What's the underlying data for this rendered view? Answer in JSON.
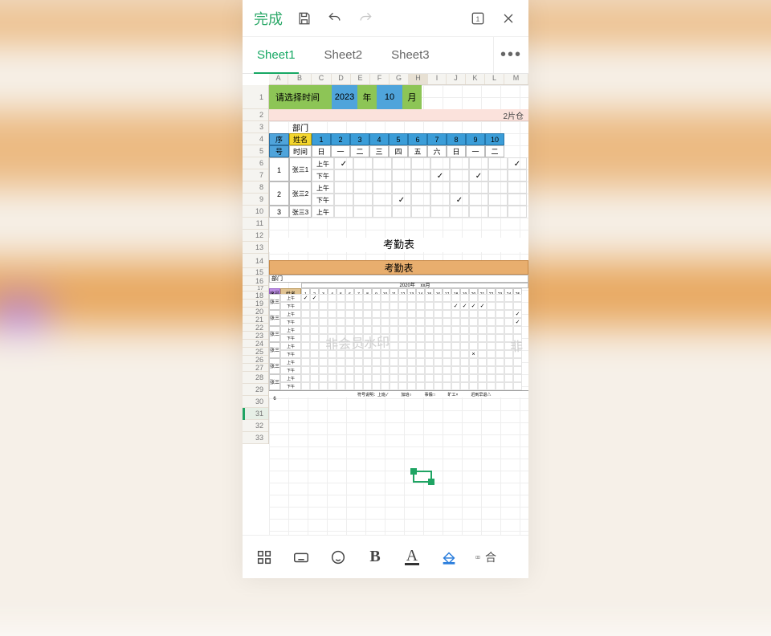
{
  "topbar": {
    "done": "完成"
  },
  "tabs": {
    "items": [
      "Sheet1",
      "Sheet2",
      "Sheet3"
    ],
    "active": 0
  },
  "columns": [
    "A",
    "B",
    "C",
    "D",
    "E",
    "F",
    "G",
    "H",
    "I",
    "J",
    "K",
    "L",
    "M"
  ],
  "column_selected": "H",
  "rows": [
    1,
    2,
    3,
    4,
    5,
    6,
    7,
    8,
    9,
    10,
    11,
    12,
    13,
    14,
    15,
    16,
    17,
    18,
    19,
    20,
    21,
    22,
    23,
    24,
    25,
    26,
    27,
    28,
    29,
    30,
    31,
    32,
    33
  ],
  "time_picker": {
    "label": "请选择时间",
    "year": "2023",
    "year_unit": "年",
    "month": "10",
    "month_unit": "月"
  },
  "r2_right_text": "2片仓",
  "dept_label": "部门",
  "att1": {
    "header": {
      "seq": "序",
      "name": "姓名",
      "days": [
        "1",
        "2",
        "3",
        "4",
        "5",
        "6",
        "7",
        "8",
        "9",
        "10"
      ]
    },
    "header2": {
      "seq": "号",
      "time": "时间",
      "dow": [
        "日",
        "一",
        "二",
        "三",
        "四",
        "五",
        "六",
        "日",
        "一",
        "二"
      ]
    },
    "rows": [
      {
        "idx": "1",
        "name": "张三1",
        "am": [
          "✓",
          "",
          "",
          "",
          "",
          "",
          "",
          "",
          "",
          "✓"
        ],
        "pm": [
          "",
          "",
          "",
          "",
          "",
          "✓",
          "",
          "✓",
          "",
          ""
        ]
      },
      {
        "idx": "2",
        "name": "张三2",
        "am": [
          "",
          "",
          "",
          "",
          "",
          "",
          "",
          "",
          "",
          ""
        ],
        "pm": [
          "",
          "",
          "",
          "✓",
          "",
          "",
          "✓",
          "",
          "",
          ""
        ]
      },
      {
        "idx": "3",
        "name": "张三3",
        "am": [
          "",
          "",
          "",
          "",
          "",
          "",
          "",
          "",
          "",
          ""
        ],
        "pm": []
      }
    ],
    "half_labels": {
      "am": "上午",
      "pm": "下午"
    }
  },
  "title1": "考勤表",
  "title2": "考勤表",
  "att2": {
    "dept": "部门",
    "banner_year": "2020年",
    "banner_month": "xx月",
    "side1": "序号",
    "side2": "姓名",
    "days": [
      "1",
      "2",
      "3",
      "4",
      "5",
      "6",
      "7",
      "8",
      "9",
      "10",
      "11",
      "12",
      "13",
      "14",
      "15",
      "16",
      "17",
      "18",
      "19",
      "20",
      "21",
      "22",
      "23",
      "24",
      "25"
    ],
    "people": [
      "张三1",
      "张三2",
      "张三3",
      "张三4",
      "张三5",
      "张三6"
    ],
    "half": {
      "am": "上午",
      "pm": "下午"
    },
    "marks": {
      "0": {
        "am": {
          "0": "✓",
          "1": "✓"
        },
        "pm": {
          "17": "✓",
          "18": "✓",
          "19": "✓",
          "20": "✓"
        }
      },
      "1": {
        "am": {
          "24": "✓"
        },
        "pm": {
          "24": "✓"
        }
      },
      "3": {
        "pm": {
          "19": "×"
        }
      }
    },
    "legend": [
      "符号说明：上班✓",
      "加班○",
      "事假□",
      "旷工×",
      "迟到早退△"
    ]
  },
  "watermark": "非会员水印",
  "selection": {
    "row": 31,
    "col": "H"
  },
  "toolbar": {
    "merge_label": "合"
  }
}
